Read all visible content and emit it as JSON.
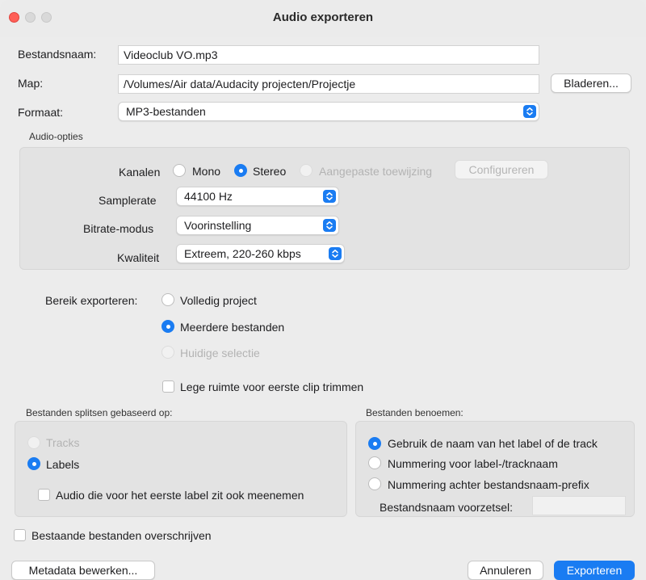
{
  "window": {
    "title": "Audio exporteren"
  },
  "file": {
    "name_label": "Bestandsnaam:",
    "name_value": "Videoclub VO.mp3",
    "folder_label": "Map:",
    "folder_value": "/Volumes/Air data/Audacity projecten/Projectje",
    "browse_label": "Bladeren...",
    "format_label": "Formaat:",
    "format_value": "MP3-bestanden"
  },
  "audio_options": {
    "section_label": "Audio-opties",
    "channels_label": "Kanalen",
    "channel_mono": "Mono",
    "channel_stereo": "Stereo",
    "channel_custom": "Aangepaste toewijzing",
    "configure_label": "Configureren",
    "samplerate_label": "Samplerate",
    "samplerate_value": "44100 Hz",
    "bitrate_mode_label": "Bitrate-modus",
    "bitrate_mode_value": "Voorinstelling",
    "quality_label": "Kwaliteit",
    "quality_value": "Extreem, 220-260 kbps"
  },
  "range": {
    "label": "Bereik exporteren:",
    "full_project": "Volledig project",
    "multiple_files": "Meerdere bestanden",
    "current_selection": "Huidige selectie",
    "trim_label": "Lege ruimte voor eerste clip trimmen"
  },
  "split": {
    "section_label": "Bestanden splitsen gebaseerd op:",
    "tracks": "Tracks",
    "labels": "Labels",
    "include_audio": "Audio die voor het eerste label zit ook meenemen"
  },
  "naming": {
    "section_label": "Bestanden benoemen:",
    "use_label_name": "Gebruik de naam van het label of de track",
    "numbering_before": "Nummering voor label-/tracknaam",
    "numbering_after": "Nummering achter bestandsnaam-prefix",
    "prefix_label": "Bestandsnaam voorzetsel:",
    "prefix_value": ""
  },
  "overwrite_label": "Bestaande bestanden overschrijven",
  "footer": {
    "metadata_label": "Metadata bewerken...",
    "cancel_label": "Annuleren",
    "export_label": "Exporteren"
  },
  "colors": {
    "accent": "#1a7cf2",
    "close": "#ff5f57"
  }
}
